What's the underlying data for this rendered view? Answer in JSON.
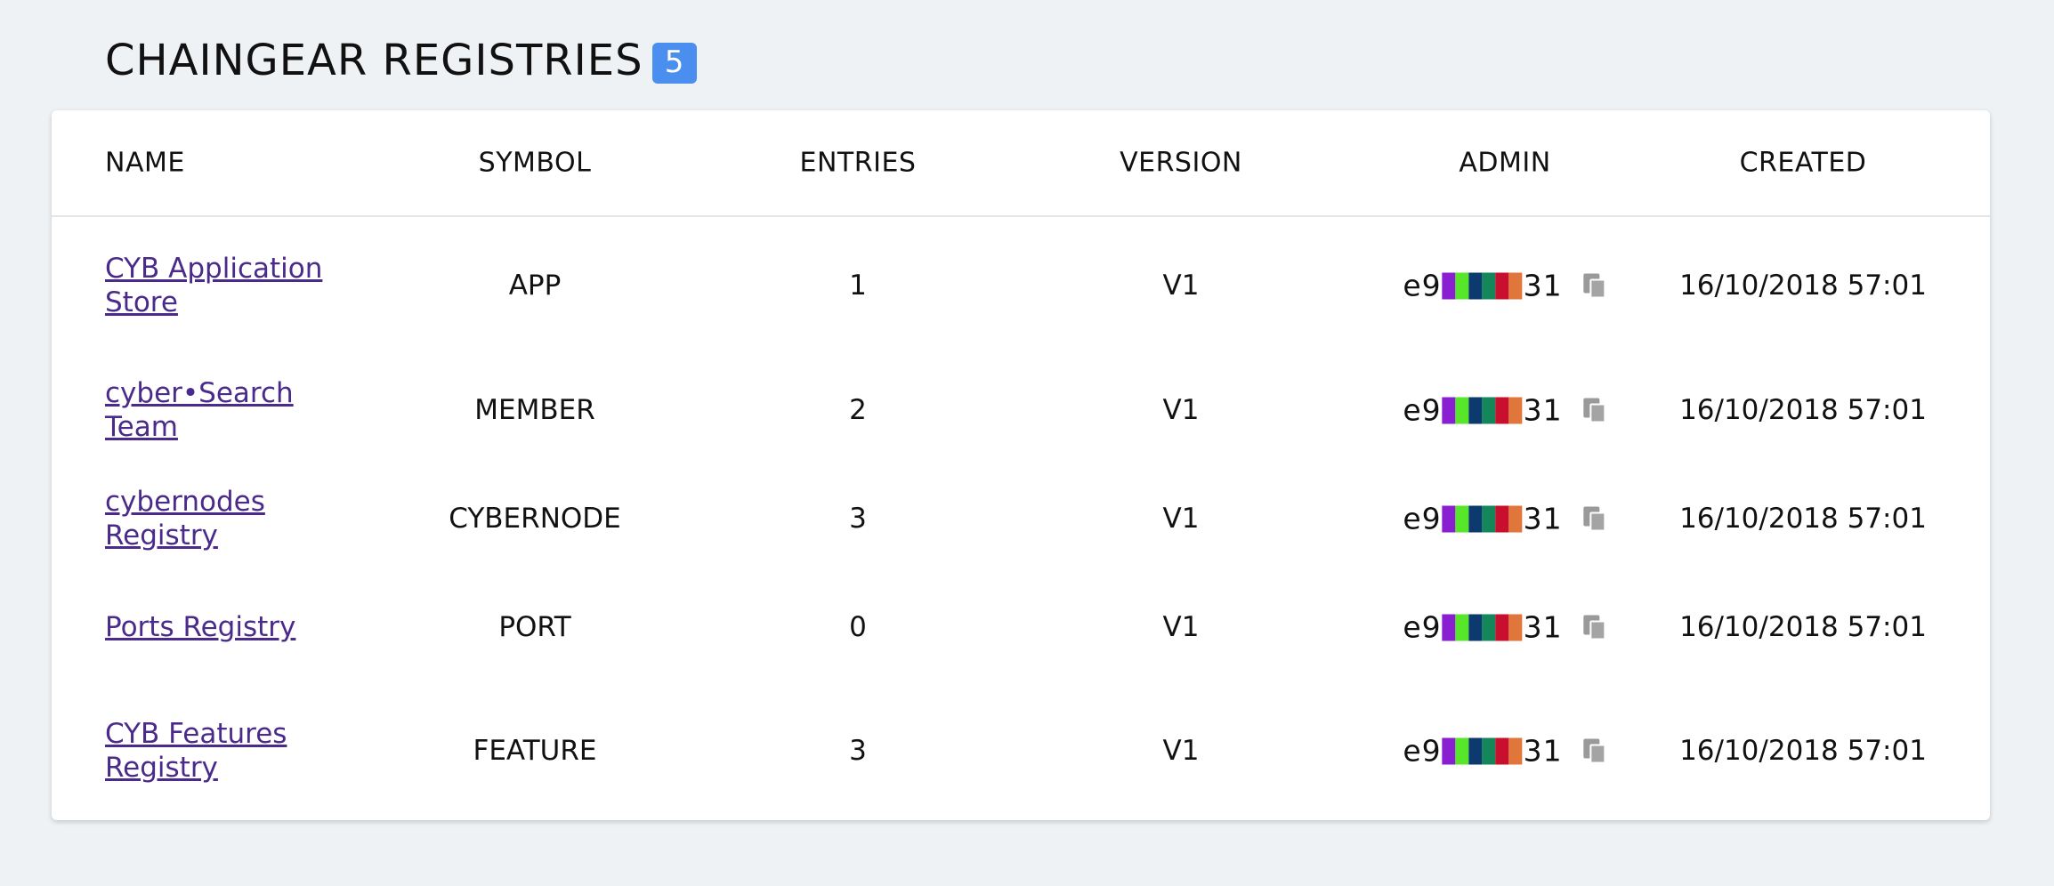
{
  "header": {
    "title": "CHAINGEAR REGISTRIES",
    "count": "5"
  },
  "columns": {
    "name": "NAME",
    "symbol": "SYMBOL",
    "entries": "ENTRIES",
    "version": "VERSION",
    "admin": "ADMIN",
    "created": "CREATED"
  },
  "admin_blockie_colors": [
    "#8a1fd1",
    "#58e62a",
    "#0c3a6e",
    "#13865a",
    "#c8102e",
    "#e0763a"
  ],
  "rows": [
    {
      "name": "CYB Application Store",
      "symbol": "APP",
      "entries": "1",
      "version": "V1",
      "admin_prefix": "e9",
      "admin_suffix": "31",
      "created": "16/10/2018 57:01"
    },
    {
      "name": "cyber•Search Team",
      "symbol": "MEMBER",
      "entries": "2",
      "version": "V1",
      "admin_prefix": "e9",
      "admin_suffix": "31",
      "created": "16/10/2018 57:01"
    },
    {
      "name": "cybernodes Registry",
      "symbol": "CYBERNODE",
      "entries": "3",
      "version": "V1",
      "admin_prefix": "e9",
      "admin_suffix": "31",
      "created": "16/10/2018 57:01"
    },
    {
      "name": "Ports Registry",
      "symbol": "PORT",
      "entries": "0",
      "version": "V1",
      "admin_prefix": "e9",
      "admin_suffix": "31",
      "created": "16/10/2018 57:01"
    },
    {
      "name": "CYB Features Registry",
      "symbol": "FEATURE",
      "entries": "3",
      "version": "V1",
      "admin_prefix": "e9",
      "admin_suffix": "31",
      "created": "16/10/2018 57:01"
    }
  ]
}
